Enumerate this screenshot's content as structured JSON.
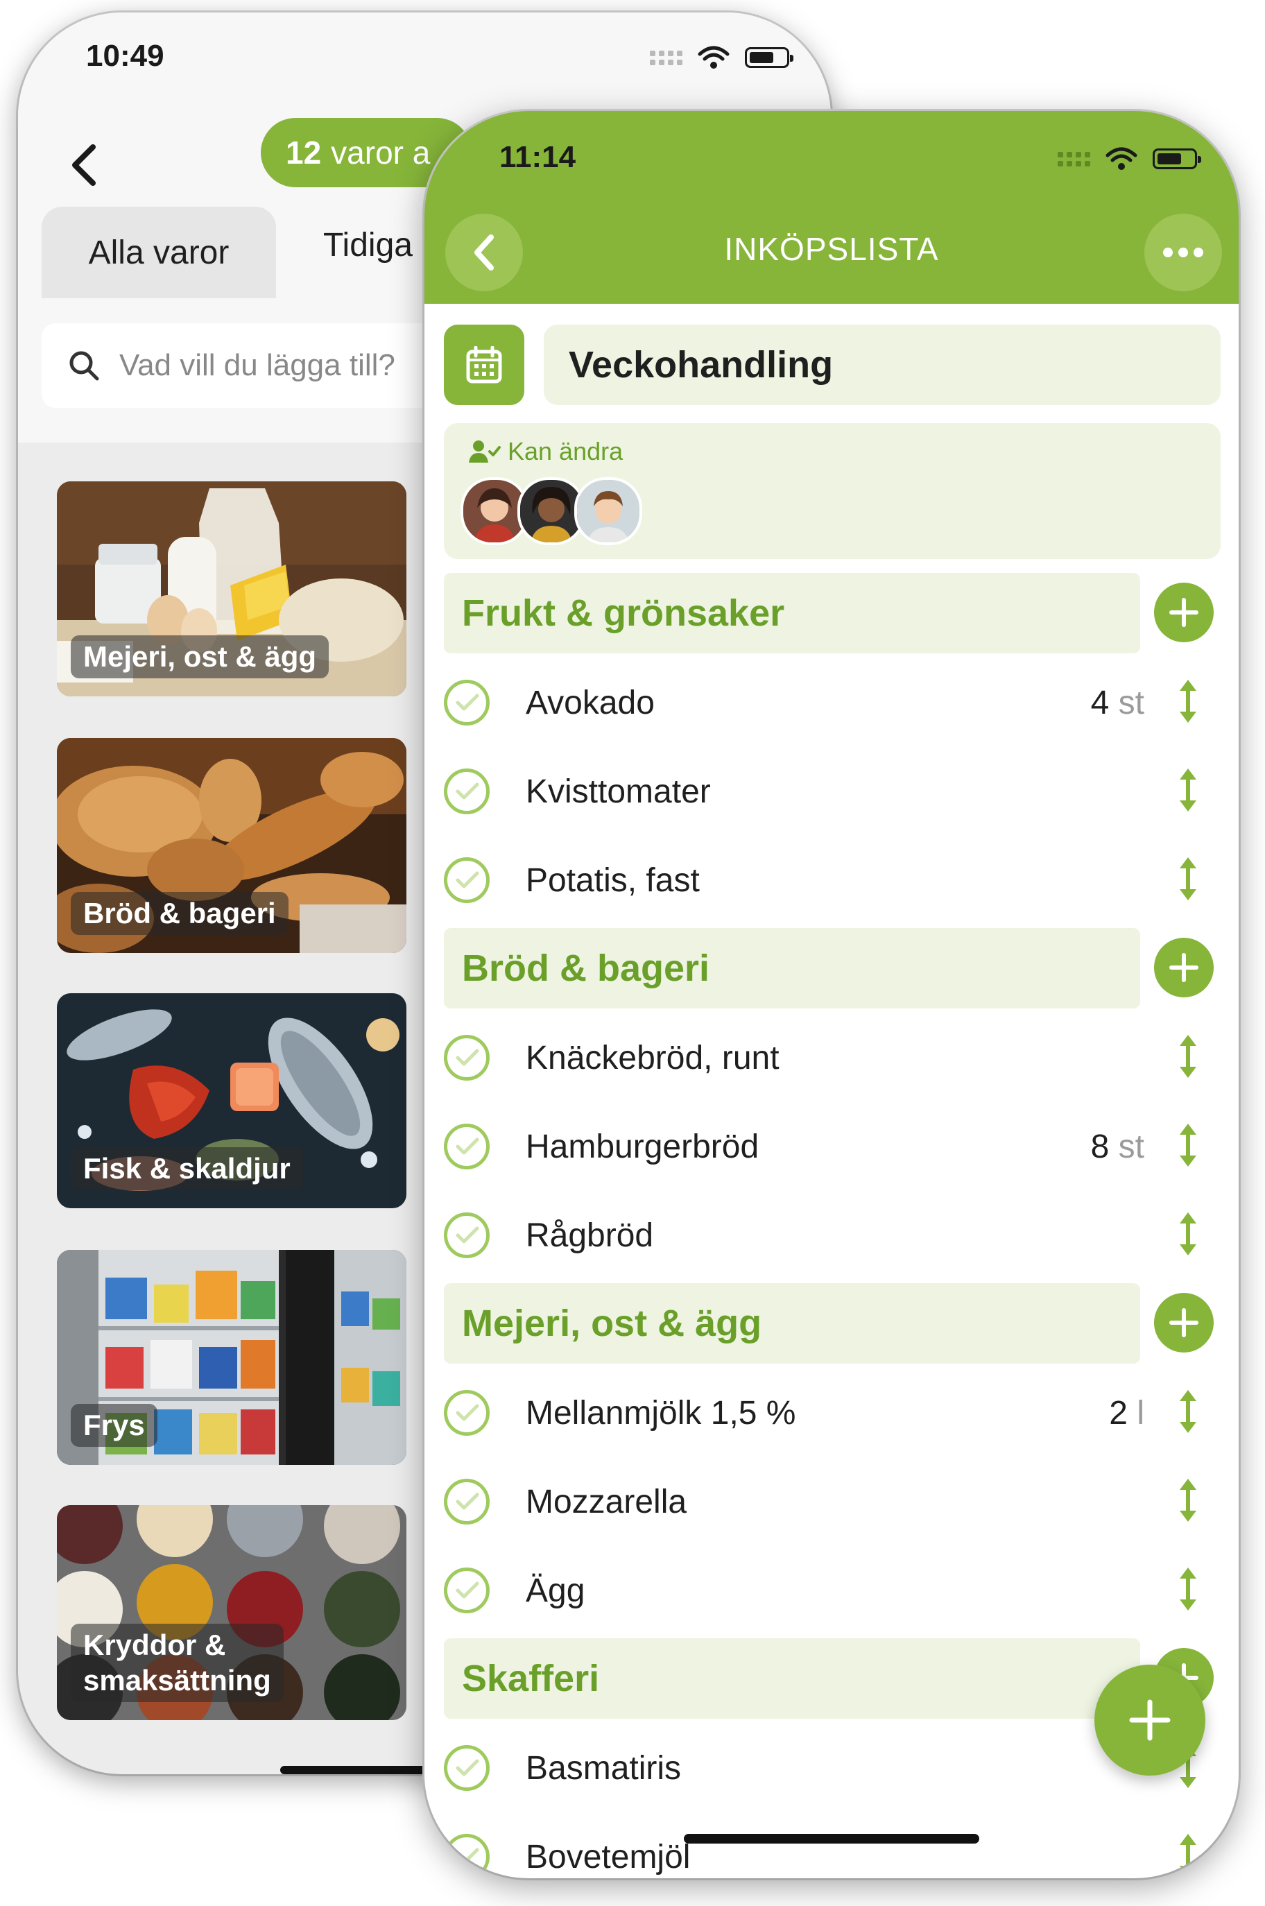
{
  "back_screen": {
    "status_time": "10:49",
    "count_number": "12",
    "count_text": "varor a",
    "tabs": [
      "Alla varor",
      "Tidiga"
    ],
    "search_placeholder": "Vad vill du lägga till?",
    "categories": [
      {
        "label": "Mejeri, ost & ägg"
      },
      {
        "label": "Bröd & bageri"
      },
      {
        "label": "Fisk & skaldjur"
      },
      {
        "label": "Frys"
      },
      {
        "label_line1": "Kryddor &",
        "label_line2": "smaksättning"
      }
    ]
  },
  "front_screen": {
    "status_time": "11:14",
    "header_title": "INKÖPSLISTA",
    "list_name": "Veckohandling",
    "share_label": "Kan ändra",
    "sections": [
      {
        "title": "Frukt & grönsaker",
        "items": [
          {
            "name": "Avokado",
            "qty": "4",
            "unit": "st"
          },
          {
            "name": "Kvisttomater",
            "qty": "",
            "unit": ""
          },
          {
            "name": "Potatis, fast",
            "qty": "",
            "unit": ""
          }
        ]
      },
      {
        "title": "Bröd & bageri",
        "items": [
          {
            "name": "Knäckebröd, runt",
            "qty": "",
            "unit": ""
          },
          {
            "name": "Hamburgerbröd",
            "qty": "8",
            "unit": "st"
          },
          {
            "name": "Rågbröd",
            "qty": "",
            "unit": ""
          }
        ]
      },
      {
        "title": "Mejeri, ost & ägg",
        "items": [
          {
            "name": "Mellanmjölk 1,5 %",
            "qty": "2",
            "unit": "l"
          },
          {
            "name": "Mozzarella",
            "qty": "",
            "unit": ""
          },
          {
            "name": "Ägg",
            "qty": "",
            "unit": ""
          }
        ]
      },
      {
        "title": "Skafferi",
        "items": [
          {
            "name": "Basmatiris",
            "qty": "",
            "unit": ""
          },
          {
            "name": "Bovetemjöl",
            "qty": "",
            "unit": ""
          }
        ]
      }
    ]
  },
  "colors": {
    "brand_green": "#86b53a",
    "light_green_bg": "#eef4e1",
    "section_text": "#6aa02a"
  }
}
